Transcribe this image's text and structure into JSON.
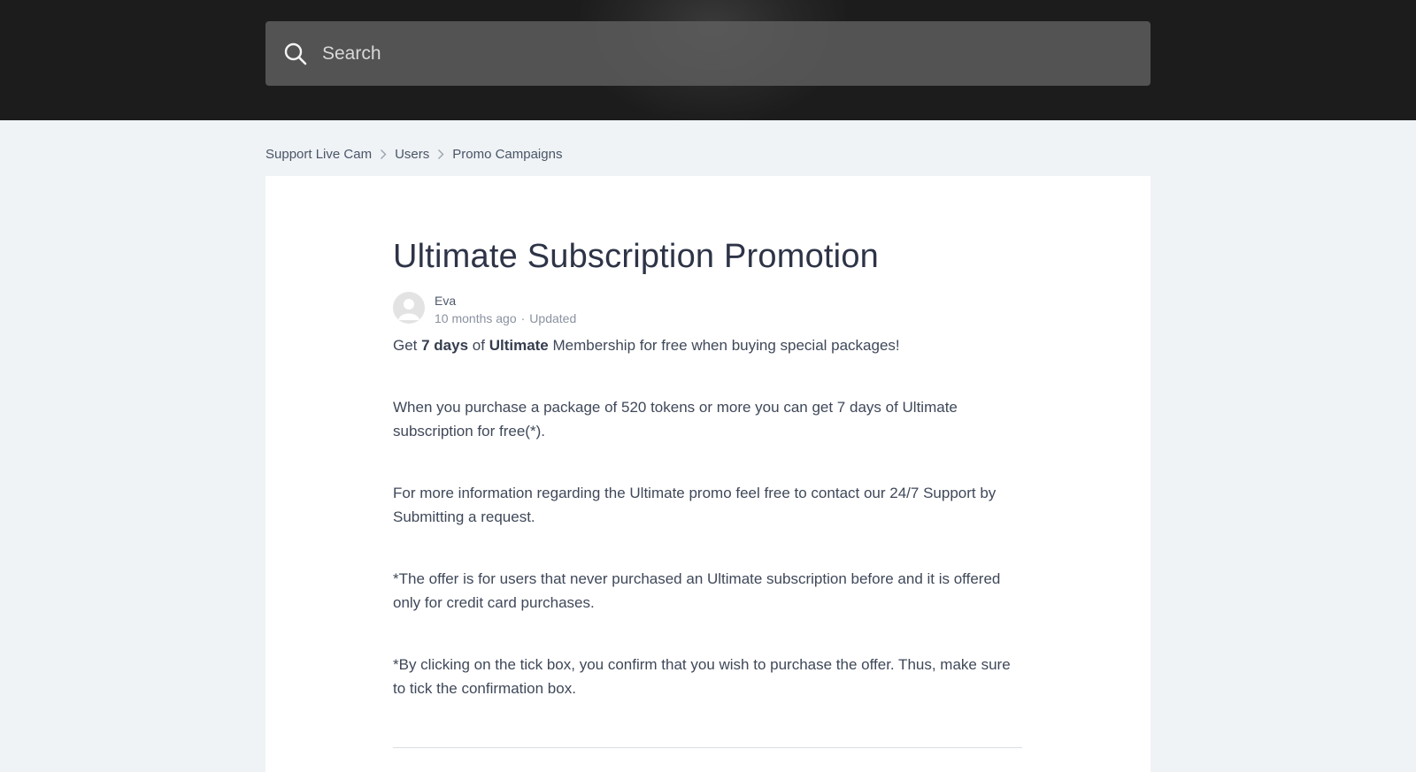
{
  "header": {
    "search": {
      "placeholder": "Search",
      "icon": "search-icon"
    }
  },
  "breadcrumb": {
    "items": [
      "Support Live Cam",
      "Users",
      "Promo Campaigns"
    ]
  },
  "article": {
    "title": "Ultimate Subscription Promotion",
    "author": {
      "name": "Eva",
      "avatar_icon": "avatar-user-icon"
    },
    "meta": {
      "time": "10 months ago",
      "separator": "·",
      "status": "Updated"
    },
    "intro": {
      "p1": "Get ",
      "b1": "7 days",
      "p2": " of ",
      "b2": "Ultimate",
      "p3": " Membership for free when buying special packages!"
    },
    "paragraphs": [
      "When you purchase a package of 520 tokens or more you can get 7 days of Ultimate subscription for free(*).",
      "For more information regarding the Ultimate promo feel free to contact our 24/7 Support by Submitting a request.",
      "*The offer is for users that never purchased an Ultimate subscription before and it is offered only for credit card purchases.",
      "*By clicking on the tick box, you confirm that you wish to purchase the offer. Thus, make sure to tick the confirmation box."
    ]
  },
  "colors": {
    "page_bg": "#eff3f6",
    "hero_bg": "#1c1c1c",
    "card_bg": "#ffffff",
    "title": "#2e3447",
    "body_text": "#3f4859",
    "meta_text": "#8a92a0"
  }
}
